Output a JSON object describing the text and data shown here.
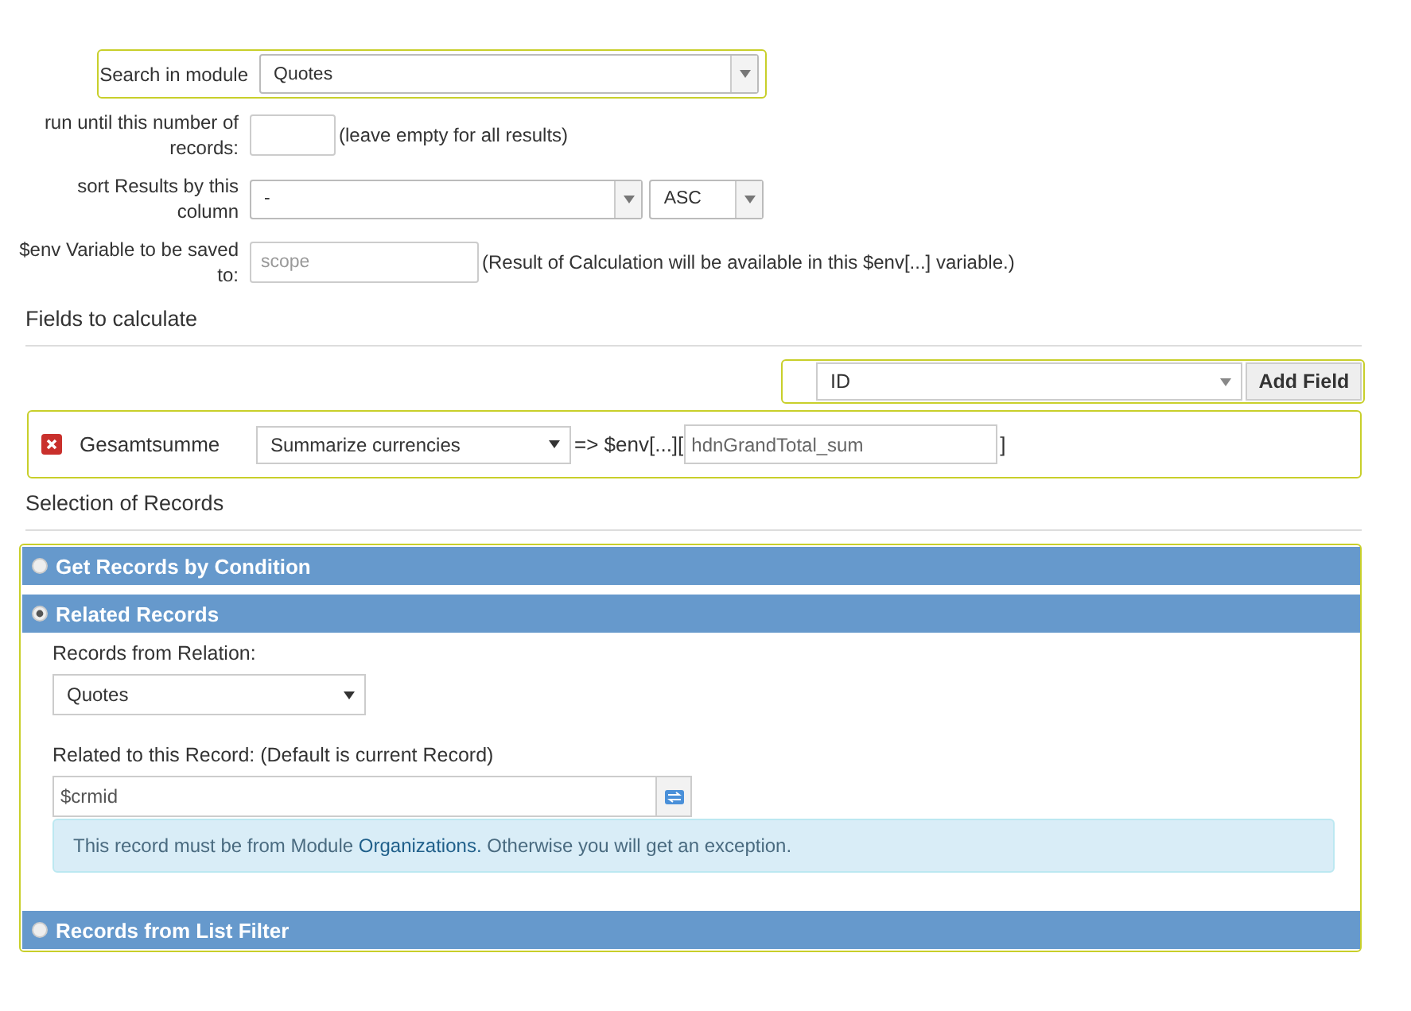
{
  "settings": [
    {
      "kind": "select",
      "label": "Search in module",
      "value": "Quotes",
      "highlighted": true
    },
    {
      "kind": "number",
      "label": "run until this number of records:",
      "hint": "(leave empty for all results)"
    },
    {
      "kind": "sort",
      "label": "sort Results by this column",
      "value": "-",
      "order": "ASC"
    },
    {
      "kind": "text",
      "label": "$env Variable to be saved to:",
      "placeholder": "scope",
      "hint": "(Result of Calculation will be available in this $env[...] variable.)"
    }
  ],
  "fields_section": {
    "title": "Fields to calculate",
    "field_select": "ID",
    "add_button": "Add Field",
    "fields": [
      {
        "name": "Gesamtsumme",
        "operation": "Summarize currencies",
        "env_prefix": "=> $env[...][",
        "variable": "hdnGrandTotal_sum",
        "env_suffix": "]"
      }
    ]
  },
  "selection_section": {
    "title": "Selection of Records",
    "panels": [
      {
        "title": "Get Records by Condition",
        "selected": false
      },
      {
        "title": "Related Records",
        "selected": true,
        "relation_label": "Records from Relation:",
        "relation": "Quotes",
        "record_label": "Related to this Record: (Default is current Record)",
        "record": "$crmid",
        "info_before": "This record must be from Module ",
        "info_link": "Organizations.",
        "info_after": " Otherwise you will get an exception."
      },
      {
        "title": "Records from List Filter",
        "selected": false
      }
    ]
  }
}
